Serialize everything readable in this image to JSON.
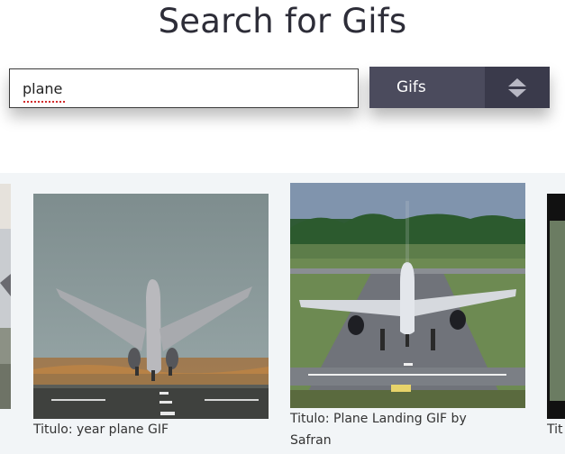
{
  "header": {
    "title": "Search for Gifs"
  },
  "search": {
    "value": "plane"
  },
  "type_select": {
    "selected": "Gifs",
    "icon": "sort-arrows-icon"
  },
  "results": [
    {
      "caption": ""
    },
    {
      "caption": "Titulo: year plane GIF"
    },
    {
      "caption": "Titulo: Plane Landing GIF by Safran"
    },
    {
      "caption": "Tit"
    }
  ],
  "colors": {
    "select_bg": "#4b4b5d",
    "select_arrow_bg": "#3a3a4b",
    "results_bg": "#f2f5f7"
  }
}
